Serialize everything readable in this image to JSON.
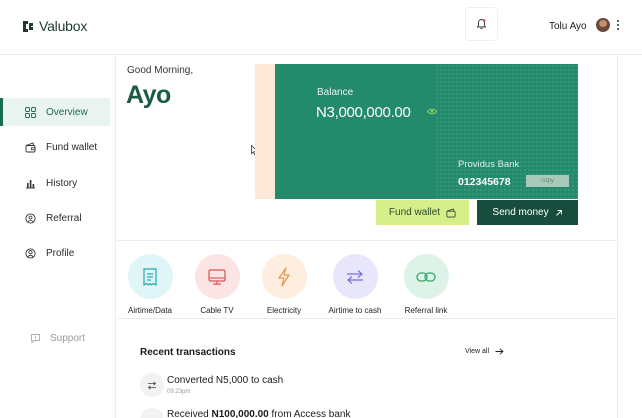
{
  "header": {
    "brand": "Valubox",
    "user_name": "Tolu Ayo"
  },
  "sidebar": {
    "items": [
      {
        "label": "Overview",
        "icon": "grid-icon",
        "active": true
      },
      {
        "label": "Fund wallet",
        "icon": "wallet-icon",
        "active": false
      },
      {
        "label": "History",
        "icon": "bar-chart-icon",
        "active": false
      },
      {
        "label": "Referral",
        "icon": "referral-icon",
        "active": false
      },
      {
        "label": "Profile",
        "icon": "user-circle-icon",
        "active": false
      }
    ],
    "support_label": "Support"
  },
  "greeting": {
    "salutation": "Good Morning,",
    "name": "Ayo"
  },
  "wallet_card": {
    "balance_label": "Balance",
    "balance_value": "N3,000,000.00",
    "bank_name": "Providus Bank",
    "account_number": "012345678",
    "copy_label": "copy"
  },
  "buttons": {
    "fund_wallet": "Fund wallet",
    "send_money": "Send money"
  },
  "quick_actions": [
    {
      "label": "Airtime/Data",
      "icon": "receipt-icon",
      "bg": "#dff5f7",
      "fg": "#2aa7b3"
    },
    {
      "label": "Cable TV",
      "icon": "tv-icon",
      "bg": "#fce4e4",
      "fg": "#d9534f"
    },
    {
      "label": "Electricity",
      "icon": "lightning-icon",
      "bg": "#fdeee0",
      "fg": "#e59a4a"
    },
    {
      "label": "Airtime to cash",
      "icon": "swap-icon",
      "bg": "#e8e6fb",
      "fg": "#7a70d6"
    },
    {
      "label": "Referral link",
      "icon": "link-icon",
      "bg": "#def3e7",
      "fg": "#3aa56c"
    }
  ],
  "transactions": {
    "title": "Recent transactions",
    "view_all": "View all",
    "items": [
      {
        "prefix": "Converted N5,000",
        "suffix": "to cash",
        "time": "09:23pm"
      },
      {
        "prefix": "Received ",
        "amount": "N100,000.00",
        "suffix": " from Access bank"
      }
    ]
  },
  "colors": {
    "brand": "#1d5a44",
    "card": "#238a6b",
    "fund_button": "#d7ef8a",
    "send_button": "#184d3d"
  }
}
